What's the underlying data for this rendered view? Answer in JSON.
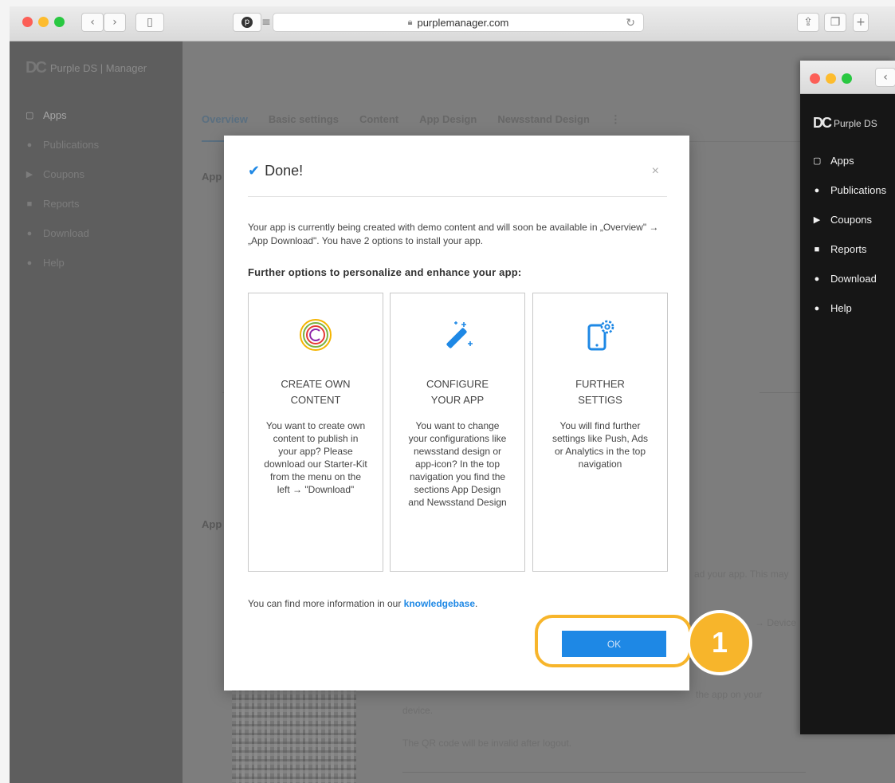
{
  "browser": {
    "url": "purplemanager.com"
  },
  "sidebar": {
    "brand": "Purple DS | Manager",
    "items": [
      {
        "label": "Apps",
        "icon": "tablet-icon"
      },
      {
        "label": "Publications",
        "icon": "globe-icon"
      },
      {
        "label": "Coupons",
        "icon": "tag-icon"
      },
      {
        "label": "Reports",
        "icon": "file-icon"
      },
      {
        "label": "Download",
        "icon": "download-icon"
      },
      {
        "label": "Help",
        "icon": "help-icon"
      }
    ]
  },
  "tabs": [
    "Overview",
    "Basic settings",
    "Content",
    "App Design",
    "Newsstand Design",
    "⋮"
  ],
  "background": {
    "section1": "App",
    "section2": "App",
    "text1": "ad your app. This may",
    "text2": "→ Device",
    "text3": "the app on your",
    "text4": "device.",
    "text5": "The QR code will be invalid after logout."
  },
  "window2": {
    "brand": "Purple DS",
    "items": [
      {
        "label": "Apps"
      },
      {
        "label": "Publications"
      },
      {
        "label": "Coupons"
      },
      {
        "label": "Reports"
      },
      {
        "label": "Download"
      },
      {
        "label": "Help"
      }
    ]
  },
  "modal": {
    "title": "Done!",
    "close": "×",
    "intro": "Your app is currently being created with demo content and will soon be available in „Overview\" → „App Download\". You have 2 options to install your app.",
    "subtitle": "Further options to personalize and enhance your app:",
    "cards": [
      {
        "icon": "content-circle-icon",
        "title_line1": "CREATE OWN",
        "title_line2": "CONTENT",
        "description": "You want to create own content to publish in your app? Please download our Starter-Kit from the menu on the left → \"Download\""
      },
      {
        "icon": "magic-wand-icon",
        "title_line1": "CONFIGURE",
        "title_line2": "YOUR APP",
        "description": "You want to change your configurations like newsstand design or app-icon? In the top navigation you find the sections App Design and Newsstand Design"
      },
      {
        "icon": "device-settings-icon",
        "title_line1": "FURTHER",
        "title_line2": "SETTIGS",
        "description": "You will find further settings like Push, Ads or Analytics in the top navigation"
      }
    ],
    "footer_text": "You can find more information in our ",
    "footer_link": "knowledgebase",
    "footer_end": ".",
    "ok_label": "OK"
  },
  "annotation": {
    "step_number": "1",
    "color": "#f7b52b"
  }
}
